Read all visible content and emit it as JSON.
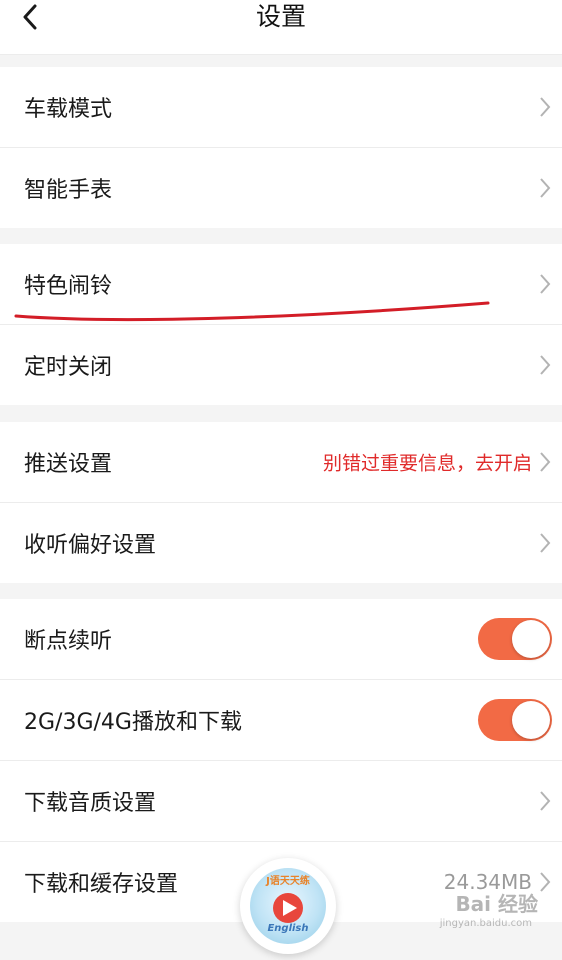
{
  "header": {
    "title": "设置",
    "back_icon": "chevron-left-icon"
  },
  "groups": [
    {
      "items": [
        {
          "label": "车载模式"
        },
        {
          "label": "智能手表"
        }
      ]
    },
    {
      "items": [
        {
          "label": "特色闹铃"
        },
        {
          "label": "定时关闭"
        }
      ]
    },
    {
      "items": [
        {
          "label": "推送设置",
          "extra": "别错过重要信息，去开启"
        },
        {
          "label": "收听偏好设置"
        }
      ]
    },
    {
      "items": [
        {
          "label": "断点续听",
          "toggle_on": true
        },
        {
          "label": "2G/3G/4G播放和下载",
          "toggle_on": true
        },
        {
          "label": "下载音质设置"
        },
        {
          "label": "下载和缓存设置",
          "extra": "24.34MB"
        }
      ]
    }
  ],
  "mini_player": {
    "cover_title": "J语天天练",
    "cover_sub": "English"
  },
  "watermark": {
    "text": "Bai 经验",
    "sub": "jingyan.baidu.com"
  },
  "colors": {
    "accent": "#f26a45",
    "promo_text": "#e02a2a",
    "annotation_line": "#d31d27",
    "background": "#f4f4f4"
  }
}
